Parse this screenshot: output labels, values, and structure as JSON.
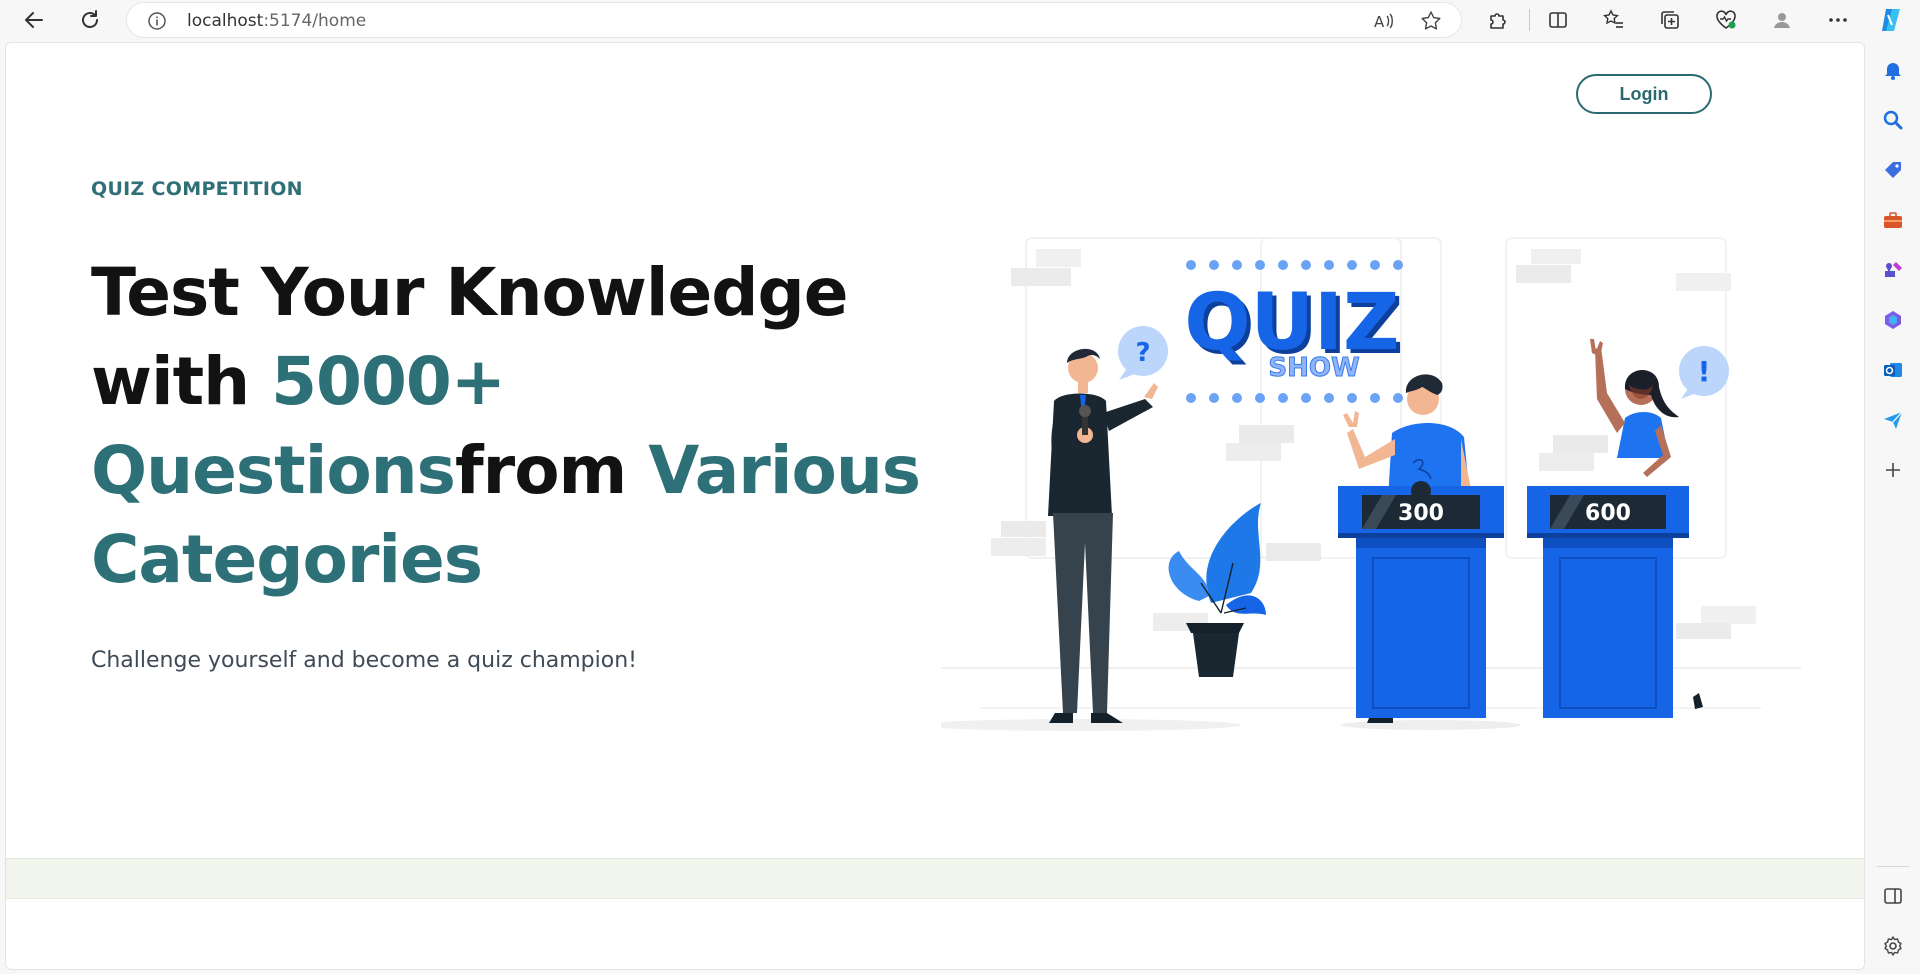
{
  "browser": {
    "url_host": "localhost",
    "url_path": ":5174/home",
    "icons": [
      "back-icon",
      "refresh-icon",
      "site-info-icon",
      "read-aloud-icon",
      "favorite-star-icon",
      "extensions-icon",
      "split-screen-icon",
      "favorites-icon",
      "collections-icon",
      "browser-essentials-icon",
      "profile-icon",
      "more-icon",
      "copilot-icon"
    ]
  },
  "sidebar": {
    "icons": [
      "bell-icon",
      "search-icon",
      "shopping-tag-icon",
      "tools-briefcase-icon",
      "games-icon",
      "microsoft-365-icon",
      "outlook-icon",
      "send-icon",
      "add-icon",
      "sidebar-toggle-icon",
      "settings-icon"
    ]
  },
  "page": {
    "login_label": "Login",
    "eyebrow": "QUIZ COMPETITION",
    "headline": {
      "part1": "Test Your Knowledge with ",
      "accent1": "5000+ Questions",
      "part2": "from ",
      "accent2": "Various Categories"
    },
    "subtitle": "Challenge yourself and become a quiz champion!",
    "illustration": {
      "sign_title": "QUIZ",
      "sign_subtitle": "SHOW",
      "bubble_left": "?",
      "bubble_right": "!",
      "podium_left_score": "300",
      "podium_right_score": "600"
    }
  },
  "colors": {
    "accent": "#2d7077",
    "illustration_blue": "#1565e6",
    "footer_band": "#f1f5ec"
  }
}
